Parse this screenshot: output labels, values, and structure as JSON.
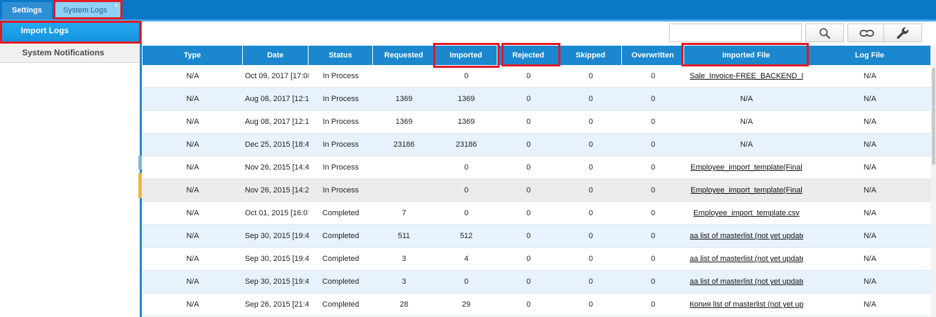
{
  "tabs": [
    {
      "label": "Settings"
    },
    {
      "label": "System Logs",
      "close": "×"
    }
  ],
  "sidebar": {
    "items": [
      {
        "label": "Import Logs"
      },
      {
        "label": "System Notifications"
      }
    ]
  },
  "toolbar": {
    "search_placeholder": "",
    "buttons": [
      "search-icon",
      "link-icon",
      "wrench-icon"
    ]
  },
  "table": {
    "columns": [
      "Type",
      "Date",
      "Status",
      "Requested",
      "Imported",
      "Rejected",
      "Skipped",
      "Overwritten",
      "Imported File",
      "Log File"
    ],
    "rows": [
      [
        "N/A",
        "Oct 09, 2017 [17:08",
        "In Process",
        "",
        "0",
        "0",
        "0",
        "0",
        "Sale_Invoice-FREE_BACKEND_I",
        "N/A"
      ],
      [
        "N/A",
        "Aug 08, 2017 [12:1",
        "In Process",
        "1369",
        "1369",
        "0",
        "0",
        "0",
        "N/A",
        "N/A"
      ],
      [
        "N/A",
        "Aug 08, 2017 [12:1",
        "In Process",
        "1369",
        "1369",
        "0",
        "0",
        "0",
        "N/A",
        "N/A"
      ],
      [
        "N/A",
        "Dec 25, 2015 [18:4",
        "In Process",
        "23186",
        "23186",
        "0",
        "0",
        "0",
        "N/A",
        "N/A"
      ],
      [
        "N/A",
        "Nov 26, 2015 [14:4",
        "In Process",
        "",
        "0",
        "0",
        "0",
        "0",
        "Employee_import_template(Final",
        "N/A"
      ],
      [
        "N/A",
        "Nov 26, 2015 [14:2",
        "In Process",
        "",
        "0",
        "0",
        "0",
        "0",
        "Employee_import_template(Final",
        "N/A"
      ],
      [
        "N/A",
        "Oct 01, 2015 [16:07",
        "Completed",
        "7",
        "0",
        "0",
        "0",
        "0",
        "Employee_import_template.csv",
        "N/A"
      ],
      [
        "N/A",
        "Sep 30, 2015 [19:4",
        "Completed",
        "511",
        "512",
        "0",
        "0",
        "0",
        "aa list of masterlist (not yet update",
        "N/A"
      ],
      [
        "N/A",
        "Sep 30, 2015 [19:4",
        "Completed",
        "3",
        "4",
        "0",
        "0",
        "0",
        "aa list of masterlist (not yet update",
        "N/A"
      ],
      [
        "N/A",
        "Sep 30, 2015 [19:4",
        "Completed",
        "3",
        "0",
        "0",
        "0",
        "0",
        "aa list of masterlist (not yet update",
        "N/A"
      ],
      [
        "N/A",
        "Sep 26, 2015 [21:4",
        "Completed",
        "28",
        "29",
        "0",
        "0",
        "0",
        "Копия list of masterlist (not yet upd",
        "N/A"
      ]
    ]
  },
  "colors": {
    "header_blue": "#1a87cf",
    "tabbar_blue": "#0a78c6",
    "highlight_red": "#e11a24",
    "alt_row": "#e8f2fc"
  }
}
